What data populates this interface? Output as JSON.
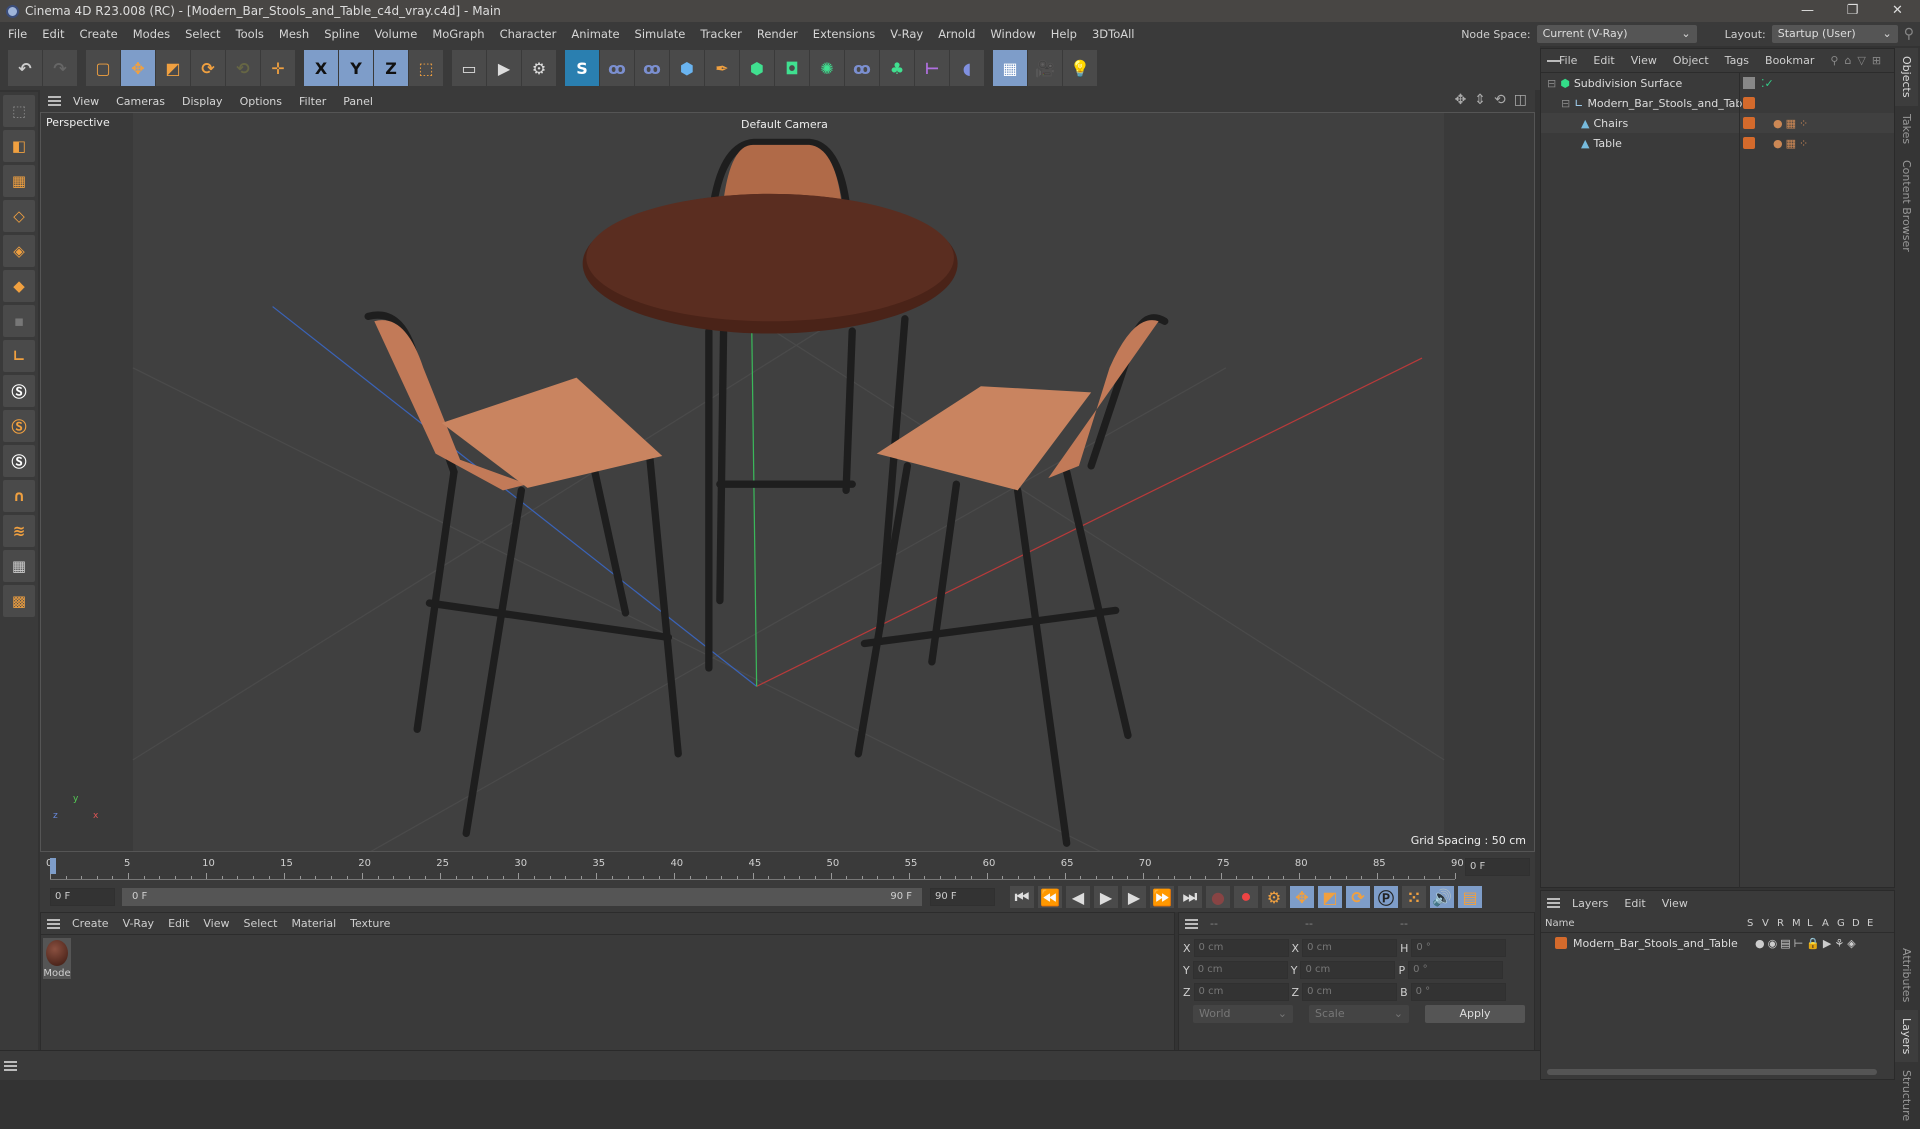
{
  "window": {
    "title": "Cinema 4D R23.008 (RC) - [Modern_Bar_Stools_and_Table_c4d_vray.c4d] - Main",
    "controls": [
      "—",
      "❐",
      "✕"
    ]
  },
  "menubar": {
    "items": [
      "File",
      "Edit",
      "Create",
      "Modes",
      "Select",
      "Tools",
      "Mesh",
      "Spline",
      "Volume",
      "MoGraph",
      "Character",
      "Animate",
      "Simulate",
      "Tracker",
      "Render",
      "Extensions",
      "V-Ray",
      "Arnold",
      "Window",
      "Help",
      "3DToAll"
    ],
    "node_space_label": "Node Space:",
    "node_space_value": "Current (V-Ray)",
    "layout_label": "Layout:",
    "layout_value": "Startup (User)"
  },
  "toolbar": {
    "axis_labels": [
      "X",
      "Y",
      "Z"
    ]
  },
  "viewport": {
    "menu": [
      "View",
      "Cameras",
      "Display",
      "Options",
      "Filter",
      "Panel"
    ],
    "view_name": "Perspective",
    "camera": "Default Camera",
    "grid_spacing": "Grid Spacing : 50 cm",
    "axes": {
      "y": "y",
      "z": "z",
      "x": "x"
    }
  },
  "timeline": {
    "ticks": [
      "0",
      "5",
      "10",
      "15",
      "20",
      "25",
      "30",
      "35",
      "40",
      "45",
      "50",
      "55",
      "60",
      "65",
      "70",
      "75",
      "80",
      "85",
      "90"
    ],
    "current_frame": "0 F",
    "start_field": "0 F",
    "range_start": "0 F",
    "range_end": "90 F",
    "end_field": "90 F"
  },
  "material_panel": {
    "menu": [
      "Create",
      "V-Ray",
      "Edit",
      "View",
      "Select",
      "Material",
      "Texture"
    ],
    "materials": [
      {
        "name": "Mode"
      }
    ]
  },
  "coordinates": {
    "headers": [
      "--",
      "--",
      "--"
    ],
    "rows": [
      {
        "a": "X",
        "av": "0 cm",
        "b": "X",
        "bv": "0 cm",
        "c": "H",
        "cv": "0 °"
      },
      {
        "a": "Y",
        "av": "0 cm",
        "b": "Y",
        "bv": "0 cm",
        "c": "P",
        "cv": "0 °"
      },
      {
        "a": "Z",
        "av": "0 cm",
        "b": "Z",
        "bv": "0 cm",
        "c": "B",
        "cv": "0 °"
      }
    ],
    "mode": "World",
    "type": "Scale",
    "apply": "Apply"
  },
  "objects_panel": {
    "menu": [
      "File",
      "Edit",
      "View",
      "Object",
      "Tags",
      "Bookmar"
    ],
    "tree": [
      {
        "name": "Subdivision Surface"
      },
      {
        "name": "Modern_Bar_Stools_and_Table"
      },
      {
        "name": "Chairs"
      },
      {
        "name": "Table"
      }
    ],
    "accent": "#d46a2c"
  },
  "layers_panel": {
    "menu": [
      "Layers",
      "Edit",
      "View"
    ],
    "columns": [
      "Name",
      "S",
      "V",
      "R",
      "M",
      "L",
      "A",
      "G",
      "D",
      "E"
    ],
    "layers": [
      {
        "name": "Modern_Bar_Stools_and_Table"
      }
    ]
  },
  "side_tabs": [
    "Objects",
    "Takes",
    "Content Browser",
    "Attributes",
    "Layers",
    "Structure"
  ]
}
